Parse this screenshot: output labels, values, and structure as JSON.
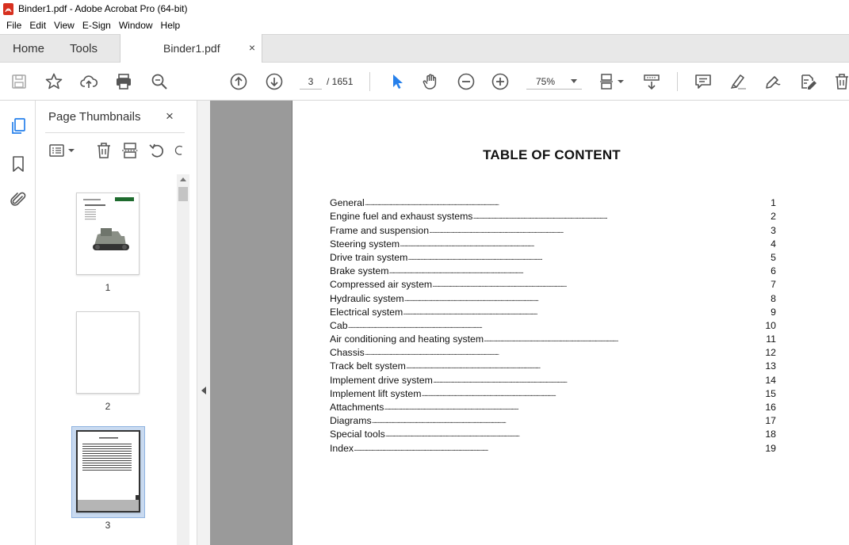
{
  "window": {
    "title": "Binder1.pdf - Adobe Acrobat Pro (64-bit)"
  },
  "menu": [
    "File",
    "Edit",
    "View",
    "E-Sign",
    "Window",
    "Help"
  ],
  "tabs": {
    "home": "Home",
    "tools": "Tools",
    "document": "Binder1.pdf",
    "close": "×"
  },
  "toolbar": {
    "page_current": "3",
    "page_total": "/ 1651",
    "zoom": "75%"
  },
  "thumbnails_panel": {
    "title": "Page Thumbnails",
    "close": "×",
    "pages": [
      {
        "label": "1",
        "cover_title": "Rubber Track Tractor"
      },
      {
        "label": "2"
      },
      {
        "label": "3"
      }
    ]
  },
  "document": {
    "title": "TABLE OF CONTENT",
    "toc": [
      {
        "name": "General",
        "page": "1"
      },
      {
        "name": "Engine fuel and exhaust systems",
        "page": "2"
      },
      {
        "name": "Frame and suspension",
        "page": "3"
      },
      {
        "name": "Steering system",
        "page": "4"
      },
      {
        "name": "Drive train system",
        "page": "5"
      },
      {
        "name": "Brake system",
        "page": "6"
      },
      {
        "name": "Compressed air system",
        "page": "7"
      },
      {
        "name": "Hydraulic system",
        "page": "8"
      },
      {
        "name": "Electrical system",
        "page": "9"
      },
      {
        "name": "Cab",
        "page": "10"
      },
      {
        "name": "Air conditioning and heating system",
        "page": "11"
      },
      {
        "name": "Chassis",
        "page": "12"
      },
      {
        "name": "Track belt system",
        "page": "13"
      },
      {
        "name": "Implement drive system",
        "page": "14"
      },
      {
        "name": "Implement lift system",
        "page": "15"
      },
      {
        "name": "Attachments",
        "page": "16"
      },
      {
        "name": "Diagrams",
        "page": "17"
      },
      {
        "name": "Special tools",
        "page": "18"
      },
      {
        "name": "Index",
        "page": "19"
      }
    ]
  },
  "colors": {
    "accent_blue": "#2680eb",
    "pdf_red": "#d7301f",
    "doc_bg": "#9a9a9a"
  }
}
